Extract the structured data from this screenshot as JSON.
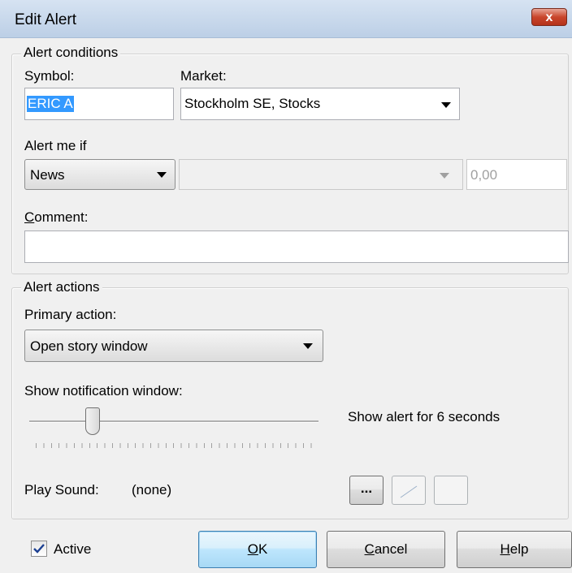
{
  "window": {
    "title": "Edit Alert",
    "close_glyph": "x"
  },
  "conditions": {
    "group_label": "Alert conditions",
    "symbol_label": "Symbol:",
    "symbol_value": "ERIC A",
    "market_label": "Market:",
    "market_value": "Stockholm SE, Stocks",
    "alert_me_if_label": "Alert me if",
    "condition_value": "News",
    "operator_value": "",
    "threshold_value": "0,00",
    "comment_label_pre": "",
    "comment_label_accel": "C",
    "comment_label_post": "omment:",
    "comment_value": ""
  },
  "actions": {
    "group_label": "Alert actions",
    "primary_action_label": "Primary action:",
    "primary_action_value": "Open story window",
    "show_notification_label": "Show notification window:",
    "slider_fraction": 0.22,
    "slider_caption": "Show alert for 6 seconds",
    "play_sound_label": "Play Sound:",
    "play_sound_value": "(none)",
    "browse_button_label": "..."
  },
  "footer": {
    "active_label": "Active",
    "active_checked": true,
    "ok_accel": "O",
    "ok_rest": "K",
    "cancel_accel": "C",
    "cancel_rest": "ancel",
    "help_accel": "H",
    "help_rest": "elp"
  },
  "colors": {
    "selection_bg": "#3399ff",
    "disabled_text": "#a0a0a0"
  }
}
